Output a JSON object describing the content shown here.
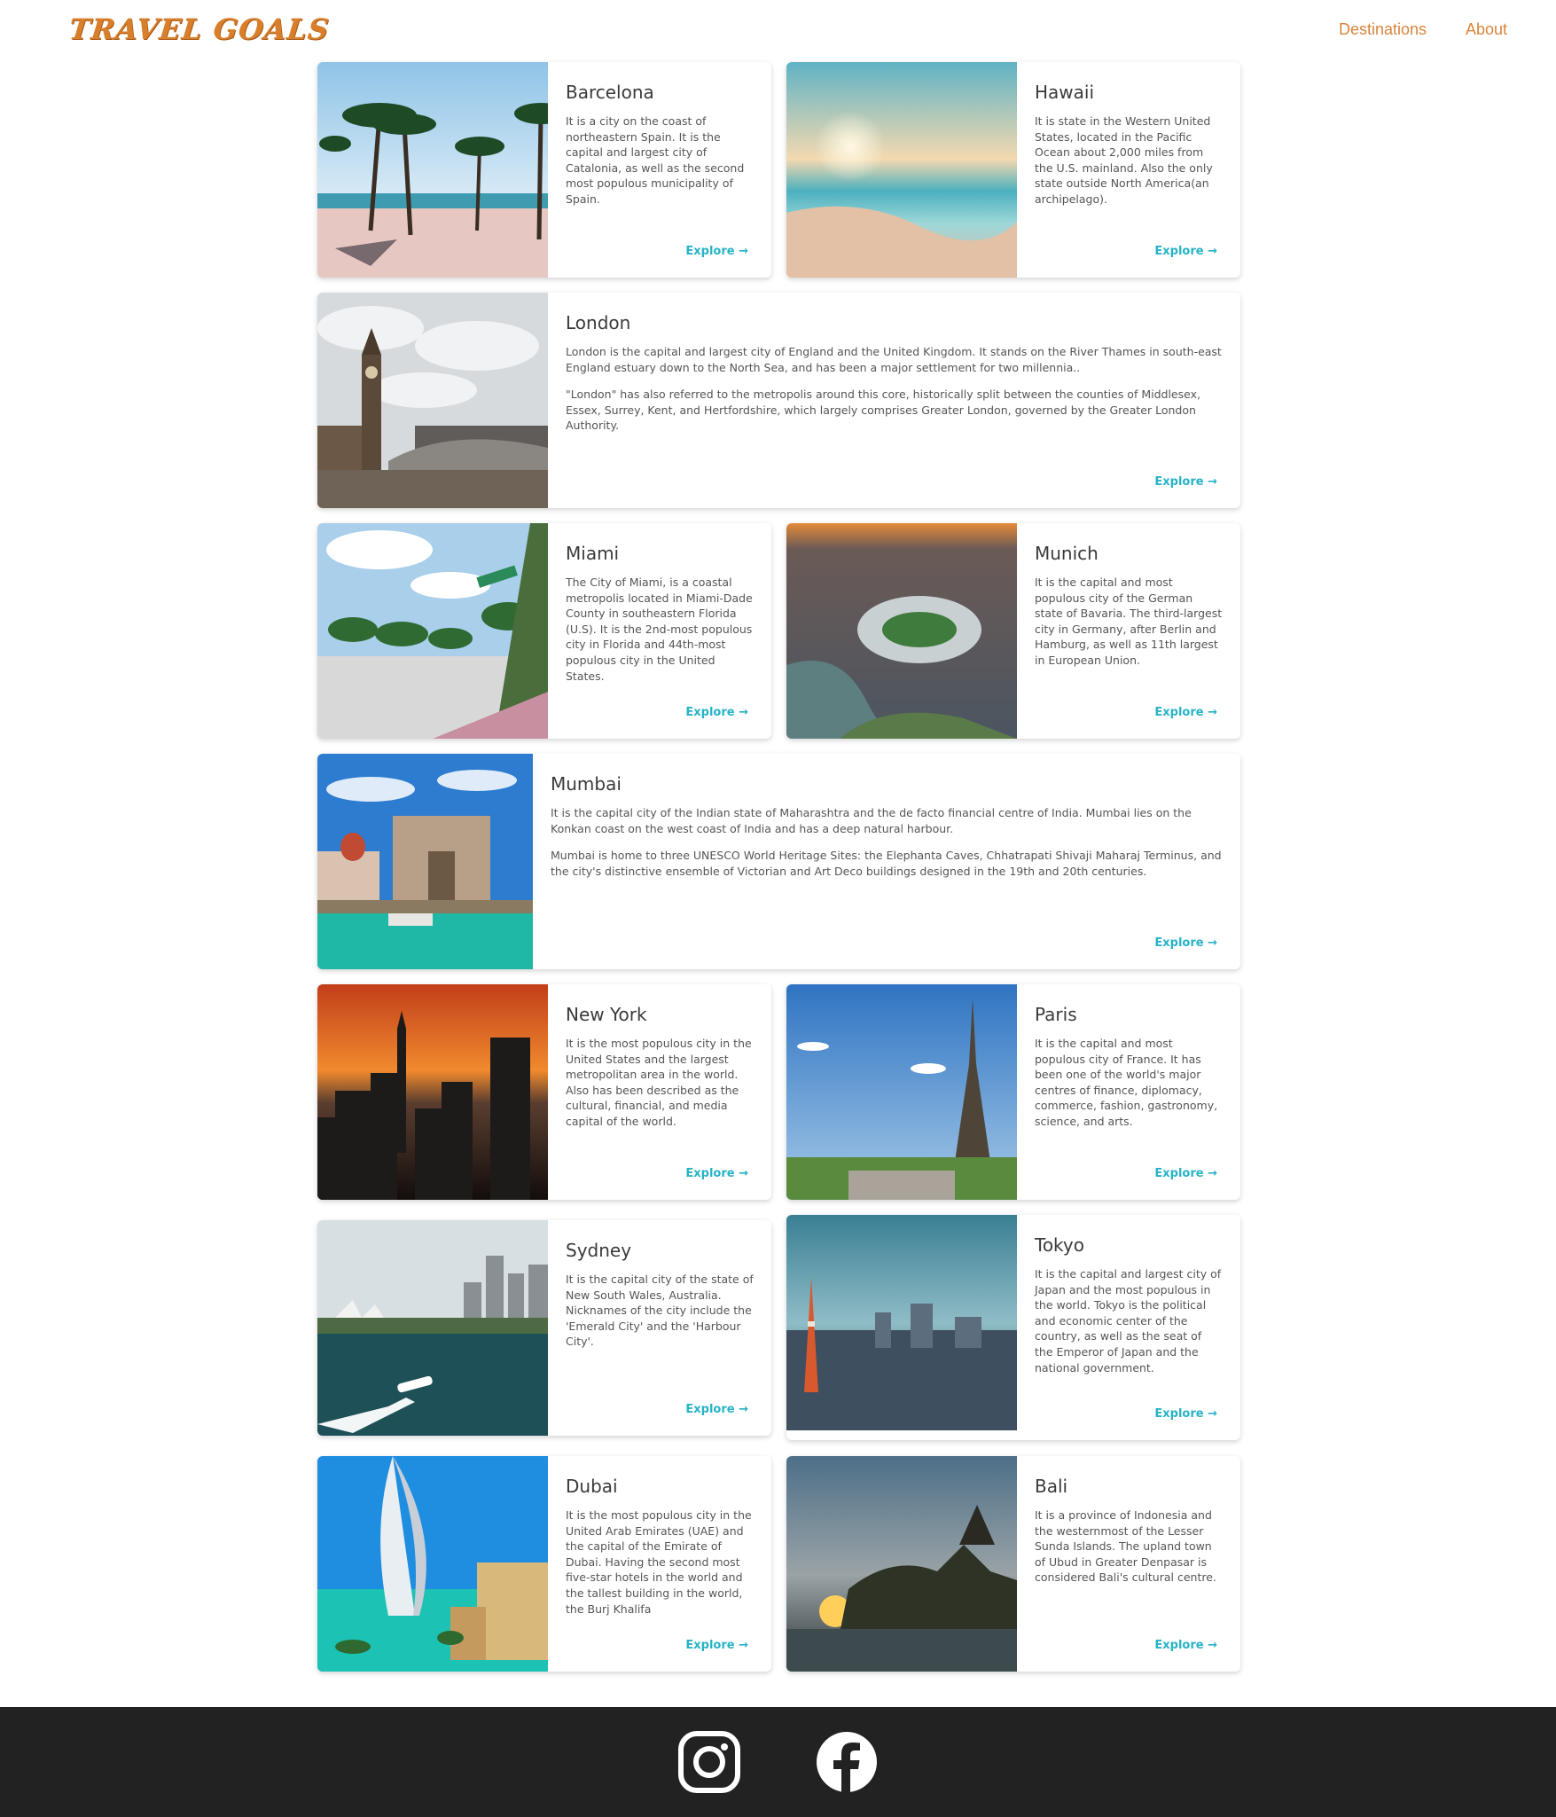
{
  "header": {
    "logo": "TRAVEL GOALS",
    "nav": {
      "destinations": "Destinations",
      "about": "About"
    }
  },
  "explore_label": "Explore →",
  "cards": {
    "barcelona": {
      "title": "Barcelona",
      "desc": "It is a city on the coast of northeastern Spain. It is the capital and largest city of Catalonia, as well as the second most populous municipality of Spain."
    },
    "hawaii": {
      "title": "Hawaii",
      "desc": "It is state in the Western United States, located in the Pacific Ocean about 2,000 miles from the U.S. mainland. Also the only state outside North America(an archipelago)."
    },
    "london": {
      "title": "London",
      "desc1": "London is the capital and largest city of England and the United Kingdom. It stands on the River Thames in south-east England estuary down to the North Sea, and has been a major settlement for two millennia..",
      "desc2": "\"London\" has also referred to the metropolis around this core, historically split between the counties of Middlesex, Essex, Surrey, Kent, and Hertfordshire, which largely comprises Greater London, governed by the Greater London Authority."
    },
    "miami": {
      "title": "Miami",
      "desc": "The City of Miami, is a coastal metropolis located in Miami-Dade County in southeastern Florida (U.S). It is the 2nd-most populous city in Florida and 44th-most populous city in the United States."
    },
    "munich": {
      "title": "Munich",
      "desc": "It is the capital and most populous city of the German state of Bavaria. The third-largest city in Germany, after Berlin and Hamburg, as well as 11th largest in European Union."
    },
    "mumbai": {
      "title": "Mumbai",
      "desc1": "It is the capital city of the Indian state of Maharashtra and the de facto financial centre of India. Mumbai lies on the Konkan coast on the west coast of India and has a deep natural harbour.",
      "desc2": "Mumbai is home to three UNESCO World Heritage Sites: the Elephanta Caves, Chhatrapati Shivaji Maharaj Terminus, and the city's distinctive ensemble of Victorian and Art Deco buildings designed in the 19th and 20th centuries."
    },
    "newyork": {
      "title": "New York",
      "desc": "It is the most populous city in the United States and the largest metropolitan area in the world. Also has been described as the cultural, financial, and media capital of the world."
    },
    "paris": {
      "title": "Paris",
      "desc": "It is the capital and most populous city of France. It has been one of the world's major centres of finance, diplomacy, commerce, fashion, gastronomy, science, and arts."
    },
    "sydney": {
      "title": "Sydney",
      "desc": "It is the capital city of the state of New South Wales, Australia. Nicknames of the city include the 'Emerald City' and the 'Harbour City'."
    },
    "tokyo": {
      "title": "Tokyo",
      "desc": "It is the capital and largest city of Japan and the most populous in the world. Tokyo is the political and economic center of the country, as well as the seat of the Emperor of Japan and the national government."
    },
    "dubai": {
      "title": "Dubai",
      "desc": "It is the most populous city in the United Arab Emirates (UAE) and the capital of the Emirate of Dubai. Having the second most five-star hotels in the world and the tallest building in the world, the Burj Khalifa"
    },
    "bali": {
      "title": "Bali",
      "desc": "It is a province of Indonesia and the westernmost of the Lesser Sunda Islands. The upland town of Ubud in Greater Denpasar is considered Bali's cultural centre."
    }
  },
  "footer": {
    "icons": [
      "instagram-icon",
      "facebook-icon"
    ]
  },
  "colors": {
    "brand": "#d97f2b",
    "link": "#27b3c7",
    "footer": "#222222"
  }
}
